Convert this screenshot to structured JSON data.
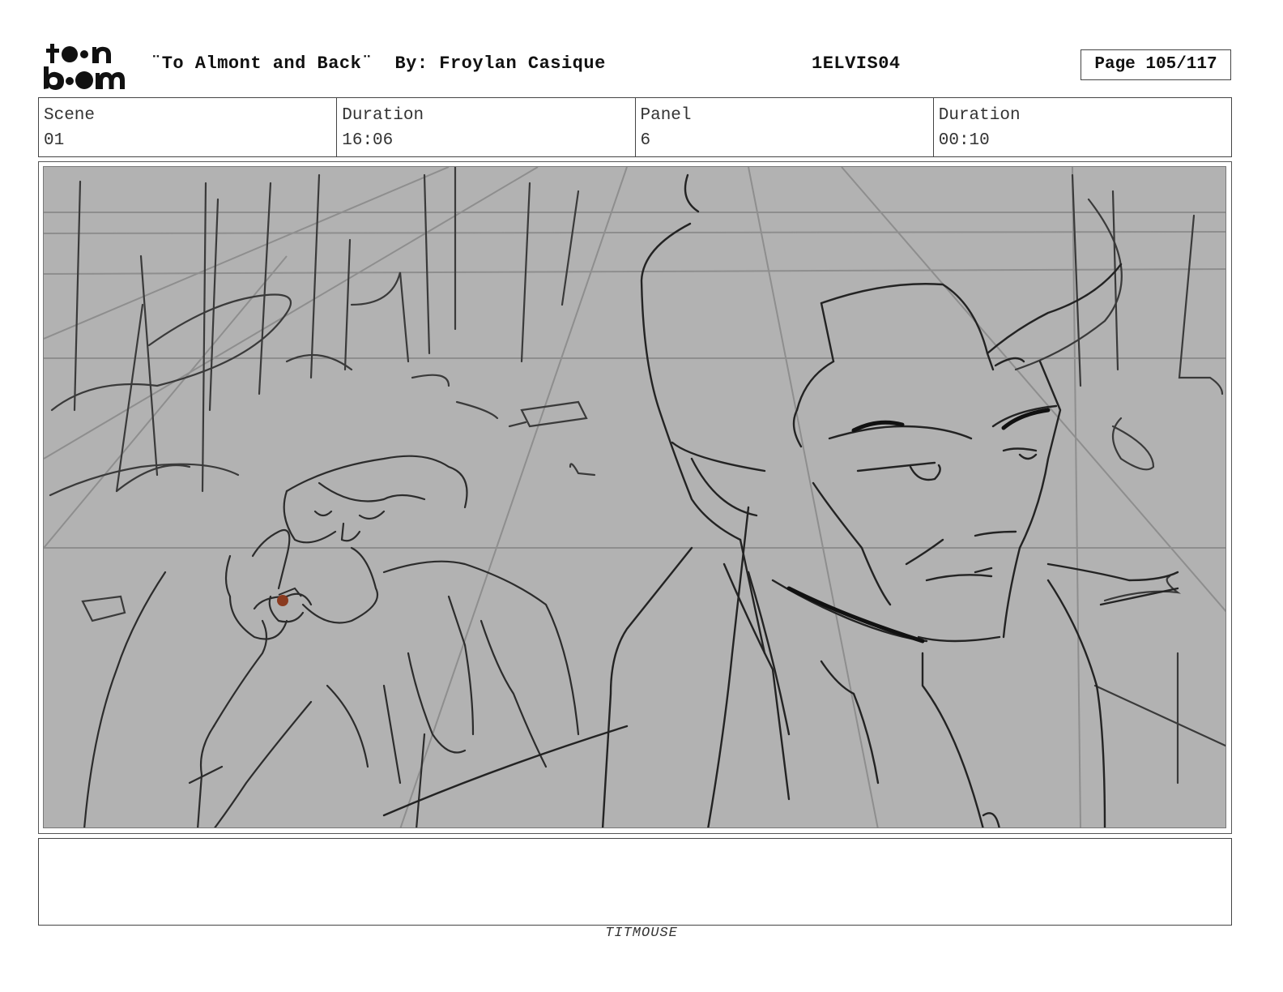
{
  "header": {
    "logo_icon": "toonboom-logo-icon",
    "title": "¨To Almont and Back¨  By: Froylan Casique",
    "production_code": "1ELVIS04",
    "page_label": "Page 105/117"
  },
  "info": {
    "scene_label": "Scene",
    "scene_value": "01",
    "scene_duration_label": "Duration",
    "scene_duration_value": "16:06",
    "panel_label": "Panel",
    "panel_value": "6",
    "panel_duration_label": "Duration",
    "panel_duration_value": "00:10"
  },
  "notes": {
    "text": ""
  },
  "footer": {
    "studio": "TITMOUSE"
  }
}
